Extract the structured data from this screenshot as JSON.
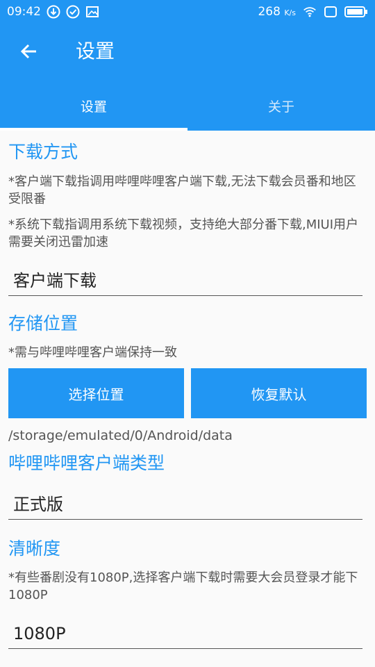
{
  "status": {
    "time": "09:42",
    "speed": "268",
    "speed_unit": "K/s"
  },
  "appbar": {
    "title": "设置"
  },
  "tabs": [
    {
      "label": "设置"
    },
    {
      "label": "关于"
    }
  ],
  "download": {
    "title": "下载方式",
    "note1": "*客户端下载指调用哔哩哔哩客户端下载,无法下载会员番和地区受限番",
    "note2": "*系统下载指调用系统下载视频，支持绝大部分番下载,MIUI用户需要关闭迅雷加速",
    "value": "客户端下载"
  },
  "storage": {
    "title": "存储位置",
    "note": "*需与哔哩哔哩客户端保持一致",
    "choose_label": "选择位置",
    "reset_label": "恢复默认",
    "path": "/storage/emulated/0/Android/data"
  },
  "client_type": {
    "title": "哔哩哔哩客户端类型",
    "value": "正式版"
  },
  "quality": {
    "title": "清晰度",
    "note": "*有些番剧没有1080P,选择客户端下载时需要大会员登录才能下1080P",
    "value": "1080P"
  }
}
